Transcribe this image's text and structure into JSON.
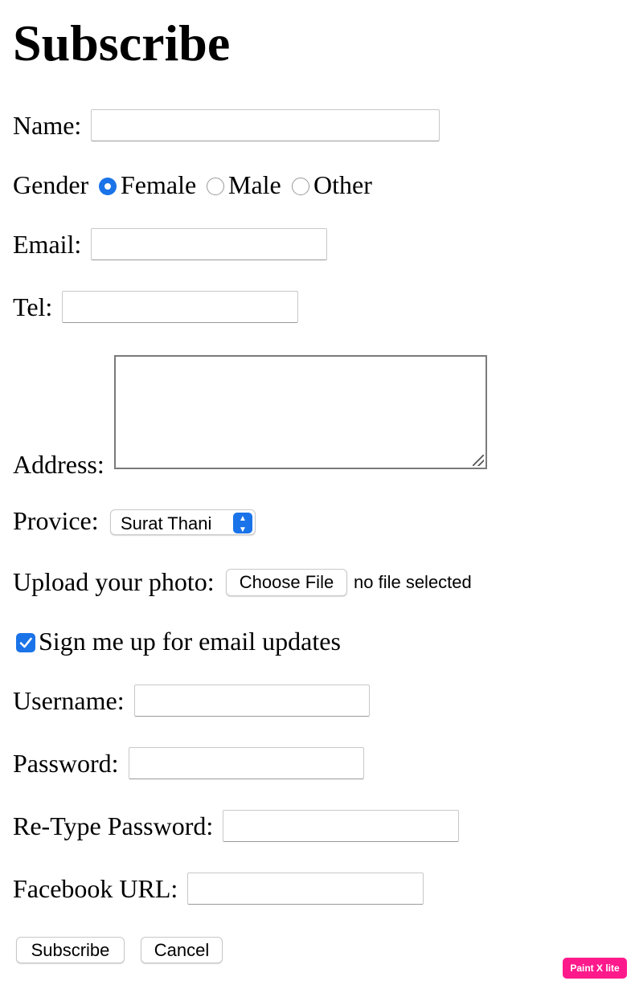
{
  "page": {
    "title": "Subscribe"
  },
  "form": {
    "name": {
      "label": "Name:",
      "value": ""
    },
    "gender": {
      "label": "Gender",
      "options": [
        {
          "label": "Female",
          "selected": true
        },
        {
          "label": "Male",
          "selected": false
        },
        {
          "label": "Other",
          "selected": false
        }
      ]
    },
    "email": {
      "label": "Email:",
      "value": ""
    },
    "tel": {
      "label": "Tel:",
      "value": ""
    },
    "address": {
      "label": "Address:",
      "value": ""
    },
    "province": {
      "label": "Provice:",
      "selected": "Surat Thani"
    },
    "photo": {
      "label": "Upload your photo:",
      "button_label": "Choose File",
      "status": "no file selected"
    },
    "newsletter": {
      "label": "Sign me up for email updates",
      "checked": true
    },
    "username": {
      "label": "Username:",
      "value": ""
    },
    "password": {
      "label": "Password:",
      "value": ""
    },
    "retype_password": {
      "label": "Re-Type Password:",
      "value": ""
    },
    "facebook": {
      "label": "Facebook URL:",
      "value": ""
    },
    "actions": {
      "submit_label": "Subscribe",
      "cancel_label": "Cancel"
    }
  },
  "badge": {
    "label": "Paint X lite"
  },
  "colors": {
    "accent": "#1a73e8",
    "badge": "#ff1a8c"
  },
  "icons": {
    "radio_selected": "radio-selected-icon",
    "select_stepper": "chevron-up-down-icon",
    "checkbox": "checkmark-icon",
    "resize": "resize-grip-icon"
  }
}
